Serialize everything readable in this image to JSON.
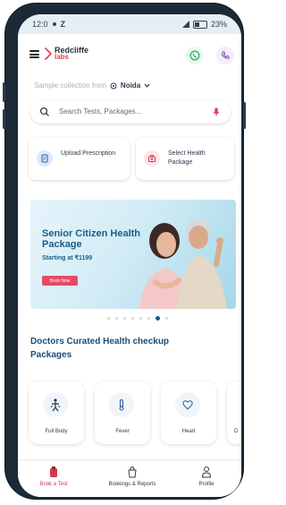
{
  "status_bar": {
    "time": "12:0",
    "left_icons": [
      "location-dot-icon",
      "z-icon"
    ],
    "battery_text": "23%"
  },
  "header": {
    "brand_top": "Redcliffe",
    "brand_bottom": "labs",
    "whatsapp_icon": "whatsapp-icon",
    "call_icon": "call-icon"
  },
  "location": {
    "label": "Sample collection from",
    "city": "Noida"
  },
  "search": {
    "placeholder": "Search Tests, Packages..."
  },
  "quick_actions": [
    {
      "label": "Upload Prescription",
      "icon": "prescription-icon"
    },
    {
      "label": "Select Health Package",
      "icon": "health-package-icon"
    }
  ],
  "banner": {
    "title": "Senior Citizen Health Package",
    "subtitle": "Starting at ₹1199",
    "cta": "Book Now"
  },
  "carousel": {
    "total": 8,
    "active_index": 6
  },
  "section": {
    "title": "Doctors Curated Health checkup Packages"
  },
  "packages": [
    {
      "label": "Full Body",
      "icon": "full-body-icon"
    },
    {
      "label": "Fever",
      "icon": "fever-icon"
    },
    {
      "label": "Heart",
      "icon": "heart-icon"
    },
    {
      "label": "D",
      "icon": "d-icon"
    }
  ],
  "bottom_nav": [
    {
      "label": "Book a Test",
      "icon": "book-test-icon",
      "active": true
    },
    {
      "label": "Bookings & Reports",
      "icon": "bookings-icon",
      "active": false
    },
    {
      "label": "Profile",
      "icon": "profile-icon",
      "active": false
    }
  ],
  "colors": {
    "brand_red": "#e63950",
    "brand_blue": "#1a5d88",
    "frame": "#1b2a36"
  }
}
